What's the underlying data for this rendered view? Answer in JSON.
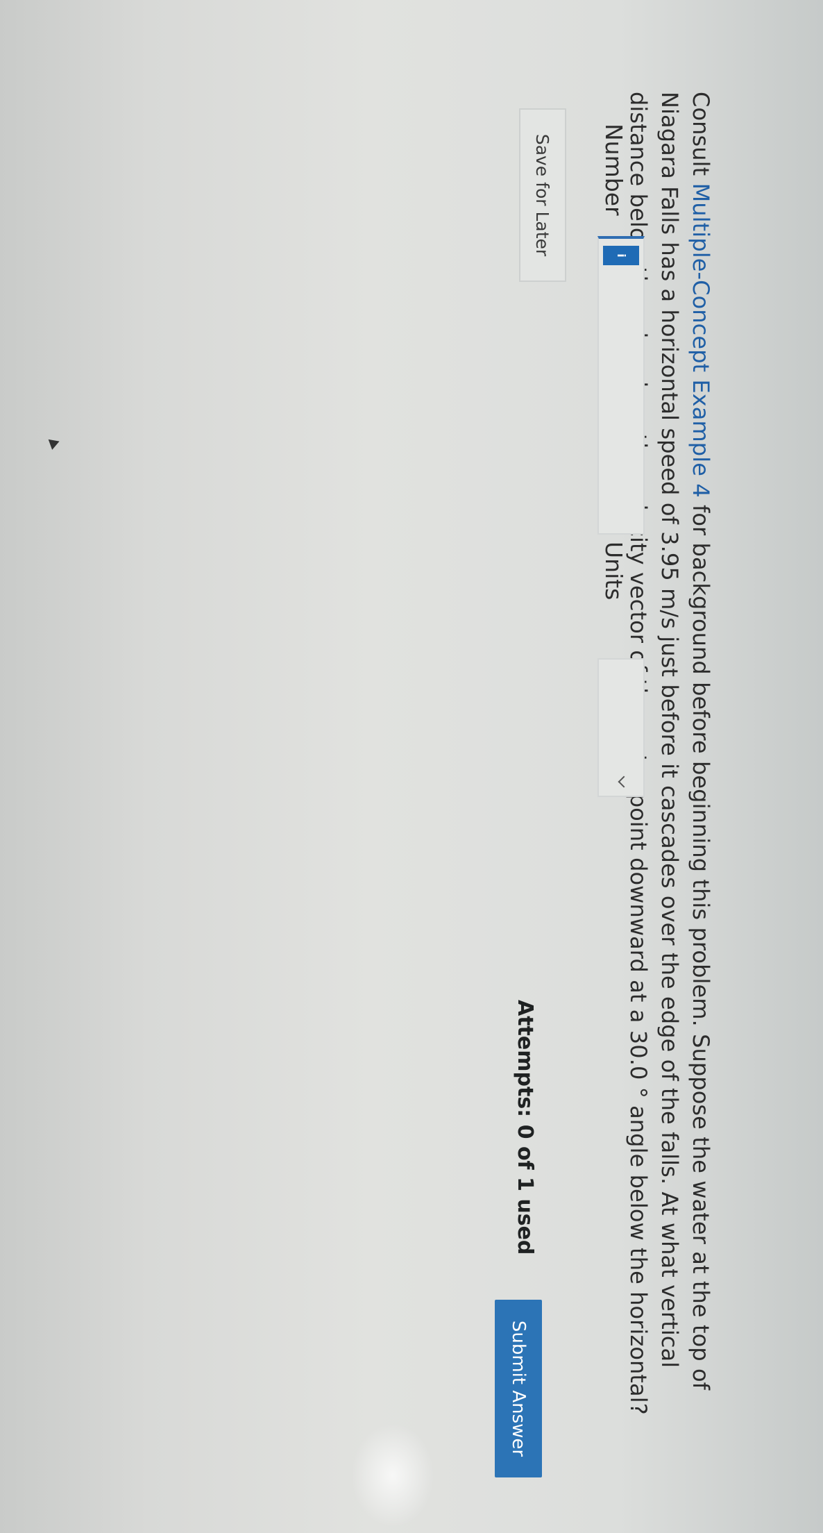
{
  "question": {
    "prefix": "Consult ",
    "link_text": "Multiple-Concept Example 4",
    "body": " for background before beginning this problem. Suppose the water at the top of Niagara Falls has a horizontal speed of 3.95 m/s just before it cascades over the edge of the falls. At what vertical distance below the edge does the velocity vector of the water point downward at a 30.0 ° angle below the horizontal?"
  },
  "answer": {
    "number_label": "Number",
    "number_value": "",
    "info_icon_text": "i",
    "units_label": "Units",
    "units_selected": ""
  },
  "actions": {
    "save_label": "Save for Later",
    "attempts_text": "Attempts: 0 of 1 used",
    "submit_label": "Submit Answer"
  },
  "colors": {
    "accent": "#2c74b6",
    "link": "#1f5fa6"
  },
  "icons": [
    "info-icon",
    "chevron-down-icon"
  ]
}
